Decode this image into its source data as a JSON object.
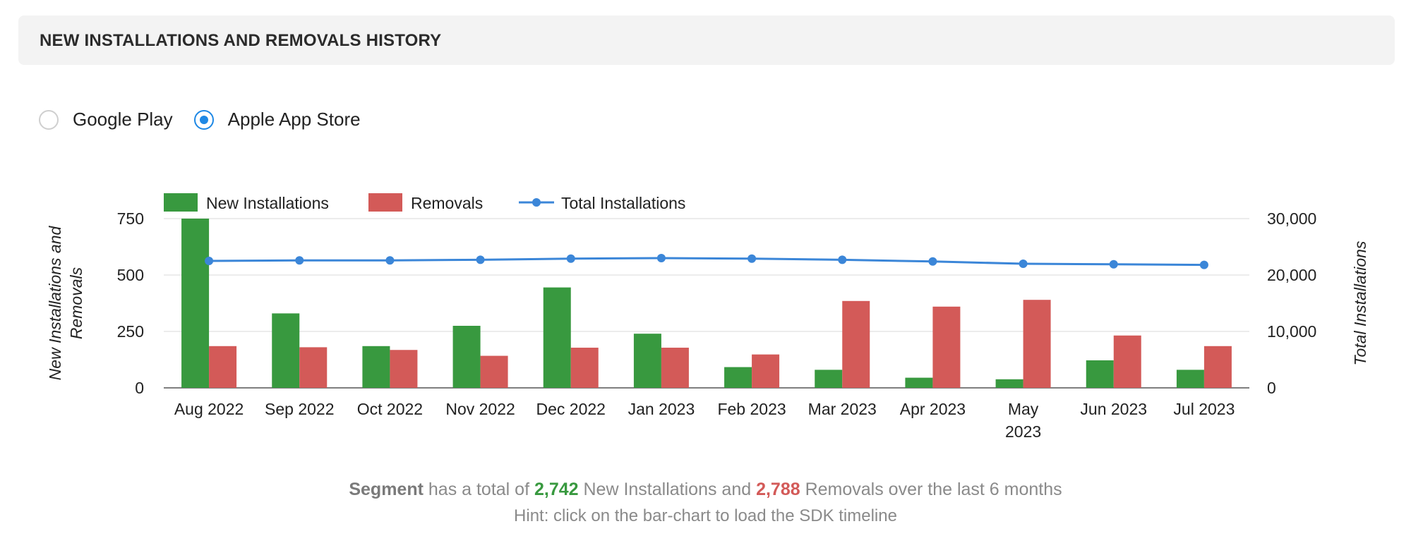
{
  "panel": {
    "title": "NEW INSTALLATIONS AND REMOVALS HISTORY"
  },
  "store_selector": {
    "options": [
      {
        "label": "Google Play",
        "selected": false
      },
      {
        "label": "Apple App Store",
        "selected": true
      }
    ]
  },
  "chart_data": {
    "type": "bar",
    "categories": [
      "Aug 2022",
      "Sep 2022",
      "Oct 2022",
      "Nov 2022",
      "Dec 2022",
      "Jan 2023",
      "Feb 2023",
      "Mar 2023",
      "Apr 2023",
      "May 2023",
      "Jun 2023",
      "Jul 2023"
    ],
    "series": [
      {
        "name": "New Installations",
        "type": "bar",
        "axis": "left",
        "color": "#38993f",
        "values": [
          750,
          330,
          185,
          275,
          445,
          240,
          92,
          80,
          45,
          38,
          122,
          80
        ]
      },
      {
        "name": "Removals",
        "type": "bar",
        "axis": "left",
        "color": "#d35a58",
        "values": [
          185,
          180,
          168,
          142,
          178,
          178,
          148,
          385,
          360,
          390,
          232,
          185
        ]
      },
      {
        "name": "Total Installations",
        "type": "line",
        "axis": "right",
        "color": "#3b86d8",
        "values": [
          22500,
          22600,
          22600,
          22700,
          22900,
          23000,
          22900,
          22700,
          22400,
          22000,
          21900,
          21800
        ]
      }
    ],
    "ylabel": "New Installations and Removals",
    "y2label": "Total Installations",
    "ylim": [
      0,
      750
    ],
    "y2lim": [
      0,
      30000
    ],
    "yticks": [
      "0",
      "250",
      "500",
      "750"
    ],
    "y2ticks": [
      "0",
      "10,000",
      "20,000",
      "30,000"
    ],
    "legend_position": "top-left",
    "grid": true
  },
  "summary": {
    "segment": "Segment",
    "text1": " has a total of ",
    "new_installations": "2,742",
    "text2": " New Installations and ",
    "removals": "2,788",
    "text3": " Removals over the last 6 months",
    "hint": "Hint: click on the bar-chart to load the SDK timeline"
  }
}
